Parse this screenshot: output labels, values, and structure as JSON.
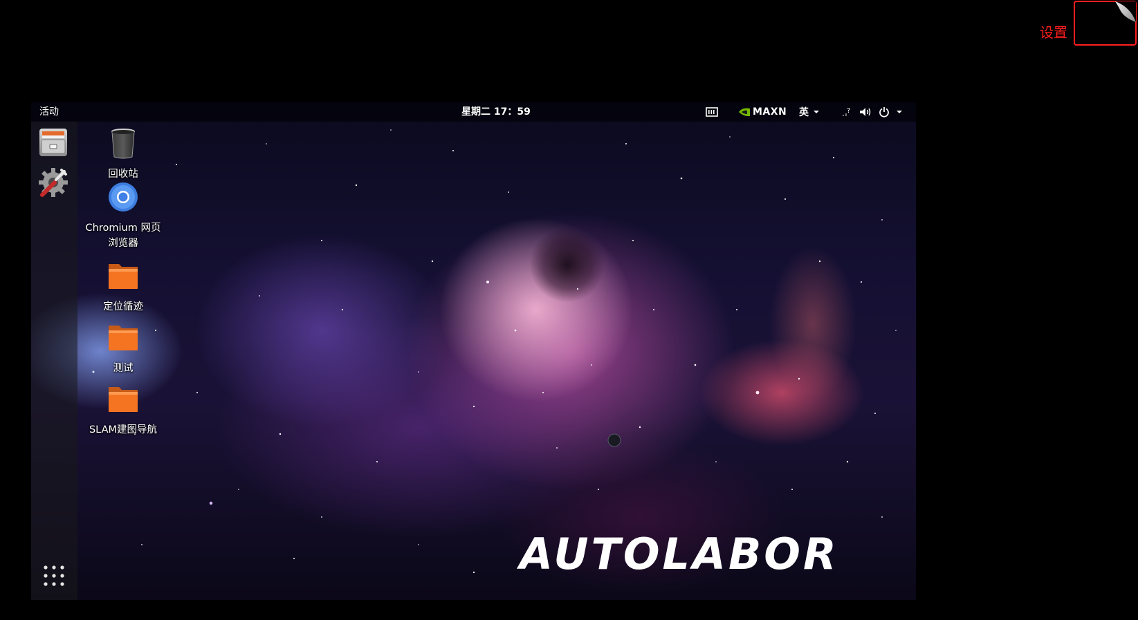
{
  "annotation": {
    "label": "设置",
    "color": "#ff1e1e"
  },
  "topbar": {
    "activities": "活动",
    "clock": "星期二 17：59",
    "maxn": "MAXN",
    "ime": "英"
  },
  "dock": {
    "items": [
      {
        "icon": "file-manager-icon"
      },
      {
        "icon": "system-tools-icon"
      }
    ],
    "show_apps_icon": "app-grid-icon"
  },
  "desktop": {
    "icons": [
      {
        "name": "回收站",
        "icon": "trash-icon"
      },
      {
        "name": "Chromium 网页浏览器",
        "icon": "chromium-icon"
      },
      {
        "name": "定位循迹",
        "icon": "folder-icon"
      },
      {
        "name": "测试",
        "icon": "folder-icon"
      },
      {
        "name": "SLAM建图导航",
        "icon": "folder-icon"
      }
    ],
    "wallpaper_text": "AUTOLABOR"
  },
  "colors": {
    "folder_orange": "#f47421",
    "chromium_blue": "#4a8ef0",
    "annotation_red": "#ff1e1e"
  }
}
